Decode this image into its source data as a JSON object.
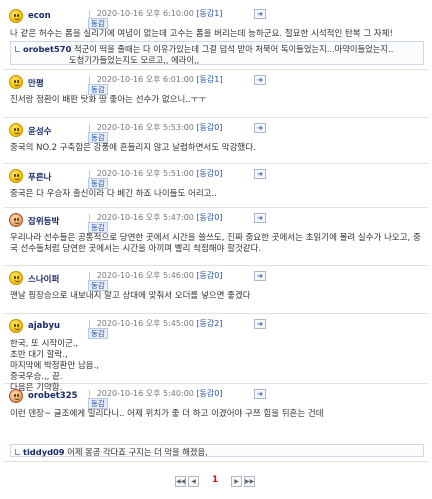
{
  "comments": [
    {
      "nick": "econ",
      "time": "2020-10-16 오후 6:10:00",
      "vote": "[동감1]",
      "tag": "동감",
      "body": "나 같은 허수는 폼을 실리기에 여념이 없는데 고수는 폼을 버리는데 능하군요. 절묘한 시석적인 탄복 그 자체!",
      "reply": {
        "nick": "orobet570",
        "line1": "적군이 떡을 줄때는 다 이유가있는데 그걸 덥석 받아 처묵어 독이들었는지...마약이들었는지..",
        "line2": "도청기가들었는지도 모르고,, 에라이,,"
      }
    },
    {
      "nick": "만평",
      "time": "2020-10-16 오후 6:01:00",
      "vote": "[동감1]",
      "tag": "동감",
      "body": "진서랑 정환이 배판 탓화 땅 좋아는 선수가 없으니..ㅜㅜ"
    },
    {
      "nick": "윤성수",
      "time": "2020-10-16 오후 5:53:00",
      "vote": "[동감0]",
      "tag": "동감",
      "body": "중국의 NO.2 구축함은 강풍에 흔들리지 않고 날렵하면서도 막강했다."
    },
    {
      "nick": "푸른나",
      "time": "2020-10-16 오후 5:51:00",
      "vote": "[동감0]",
      "tag": "동감",
      "body": "중국은 다 우승자 출신이라 다 베긴 하죠 나이들도 어리고.."
    },
    {
      "nick": "잡위등박",
      "time": "2020-10-16 오후 5:47:00",
      "vote": "[동감0]",
      "tag": "동감",
      "body": "우리나라 선수들은 공통적으로 당연한 곳에서 시간을 쓸쓰도, 진짜 중요한 곳에서는 초읽기에 몰려 실수가 나오고, 중국 선수들처럼 당연한 곳에서는 시간을 아끼며 빨리 착점해야 할것같다."
    },
    {
      "nick": "스나이퍼",
      "time": "2020-10-16 오후 5:46:00",
      "vote": "[동감0]",
      "tag": "동감",
      "body": "맨날 핑장승으로 내보내지 말고 상대에 맞춰서 오더를 넣으면 좋겠다"
    },
    {
      "nick": "ajabyu",
      "time": "2020-10-16 오후 5:45:00",
      "vote": "[동감2]",
      "tag": "동감",
      "body": "한국, 또 시작이군.,\n초반 대기 할락.,\n마지막에 박정환만 남음.,\n중국우승.,, 끝.\n다음은 기약함."
    },
    {
      "nick": "orobet325",
      "time": "2020-10-16 오후 5:40:00",
      "vote": "[동감0]",
      "tag": "동감",
      "body": "이런 덴장~ 글조에게 밀리다니.. 어제 위치가 좋 더 하고 이겼어야 구쯔 힘을 뒤흔는 건데",
      "reply": {
        "nick": "tiddyd09",
        "line1": "어제 몽공 각다죠 구지는 더 막을 해졌음,",
        "line2": ""
      }
    }
  ],
  "pager": {
    "first": "◀◀",
    "prev": "◀",
    "current": "1",
    "next": "▶",
    "last": "▶▶"
  },
  "icons": {
    "arrow": "reply-arrow-icon",
    "avatar": "smiley-face-icon"
  }
}
